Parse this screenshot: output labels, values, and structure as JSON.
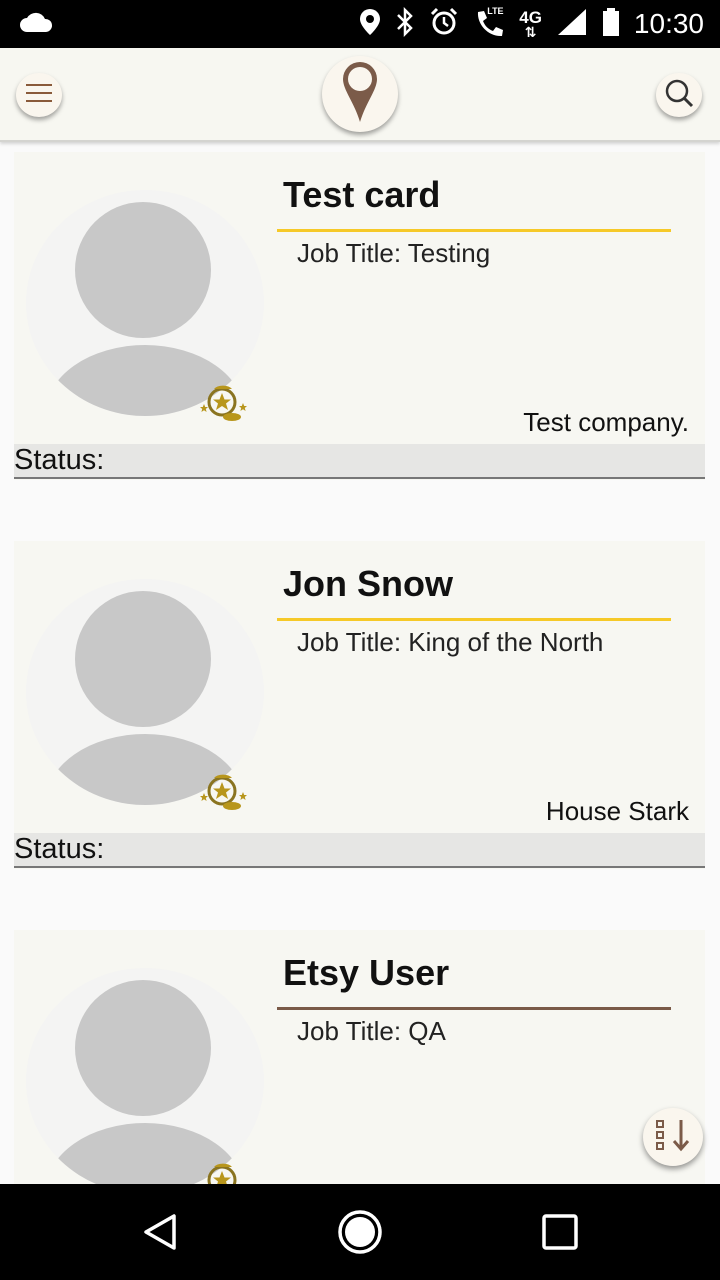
{
  "status_bar": {
    "time": "10:30",
    "network_label_top": "4G",
    "lte_label": "LTE",
    "icons": [
      "cloud-icon",
      "location-icon",
      "bluetooth-icon",
      "alarm-icon",
      "lte-call-icon",
      "signal-icon",
      "battery-icon"
    ]
  },
  "app_bar": {
    "menu_icon": "hamburger-menu-icon",
    "logo_icon": "map-pin-logo-icon",
    "search_icon": "search-icon"
  },
  "cards": [
    {
      "name": "Test card",
      "job_title": "Job Title: Testing",
      "company": "Test company.",
      "status_label": "Status:",
      "rule_color": "#f6c928"
    },
    {
      "name": "Jon Snow",
      "job_title": "Job Title: King of the North",
      "company": "House Stark",
      "status_label": "Status:",
      "rule_color": "#f6c928"
    },
    {
      "name": "Etsy User",
      "job_title": "Job Title: QA",
      "company": "",
      "status_label": "",
      "rule_color": "#7a5a48"
    }
  ],
  "fab": {
    "icon": "sort-descending-icon"
  },
  "nav_bar": {
    "icons": [
      "back-icon",
      "home-icon",
      "recents-icon"
    ]
  },
  "colors": {
    "accent_yellow": "#f6c928",
    "accent_brown": "#7a5a48",
    "card_background": "#f7f7f2"
  }
}
